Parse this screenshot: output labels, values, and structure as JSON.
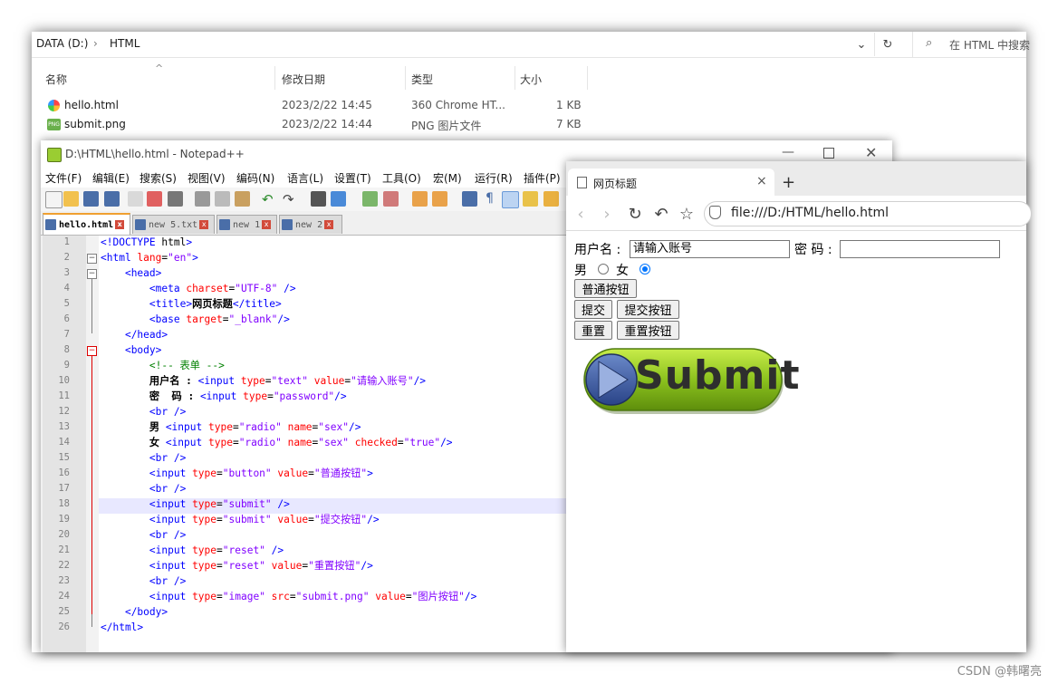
{
  "explorer": {
    "breadcrumb": [
      "DATA (D:)",
      "HTML"
    ],
    "search_placeholder": "在 HTML 中搜索",
    "columns": {
      "name": "名称",
      "date": "修改日期",
      "type": "类型",
      "size": "大小"
    },
    "files": [
      {
        "name": "hello.html",
        "date": "2023/2/22 14:45",
        "type": "360 Chrome HT...",
        "size": "1 KB"
      },
      {
        "name": "submit.png",
        "date": "2023/2/22 14:44",
        "type": "PNG 图片文件",
        "size": "7 KB"
      }
    ]
  },
  "notepad": {
    "title": "D:\\HTML\\hello.html - Notepad++",
    "menu": [
      "文件(F)",
      "编辑(E)",
      "搜索(S)",
      "视图(V)",
      "编码(N)",
      "语言(L)",
      "设置(T)",
      "工具(O)",
      "宏(M)",
      "运行(R)",
      "插件(P)"
    ],
    "tabs": [
      "hello.html",
      "new 5.txt",
      "new 1",
      "new 2"
    ],
    "line_numbers": [
      "1",
      "2",
      "3",
      "4",
      "5",
      "6",
      "7",
      "8",
      "9",
      "10",
      "11",
      "12",
      "13",
      "14",
      "15",
      "16",
      "17",
      "18",
      "19",
      "20",
      "21",
      "22",
      "23",
      "24",
      "25",
      "26"
    ],
    "code": [
      "<!DOCTYPE html>",
      "<html lang=\"en\">",
      "    <head>",
      "        <meta charset=\"UTF-8\" />",
      "        <title>网页标题</title>",
      "        <base target=\"_blank\"/>",
      "    </head>",
      "    <body>",
      "        <!-- 表单 -->",
      "        用户名 : <input type=\"text\" value=\"请输入账号\"/>",
      "        密  码 : <input type=\"password\"/>",
      "        <br />",
      "        男 <input type=\"radio\" name=\"sex\"/>",
      "        女 <input type=\"radio\" name=\"sex\" checked=\"true\"/>",
      "        <br />",
      "        <input type=\"button\" value=\"普通按钮\">",
      "        <br />",
      "        <input type=\"submit\" />",
      "        <input type=\"submit\" value=\"提交按钮\"/>",
      "        <br />",
      "        <input type=\"reset\" />",
      "        <input type=\"reset\" value=\"重置按钮\"/>",
      "        <br />",
      "        <input type=\"image\" src=\"submit.png\" value=\"图片按钮\"/>",
      "    </body>",
      "</html>"
    ]
  },
  "browser": {
    "tab_title": "网页标题",
    "url": "file:///D:/HTML/hello.html",
    "form": {
      "username_label": "用户名 :",
      "username_value": "请输入账号",
      "password_label": "密 码 :",
      "male_label": "男",
      "female_label": "女",
      "normal_button": "普通按钮",
      "submit_default": "提交",
      "submit_button": "提交按钮",
      "reset_default": "重置",
      "reset_button": "重置按钮",
      "image_button_text": "Submit",
      "gender_selected": "女"
    }
  },
  "watermark": "CSDN @韩曙亮",
  "colors": {
    "accent": "#0075ff",
    "tag": "#0000ff",
    "attr": "#ff0000",
    "value": "#8000ff",
    "comment": "#008000"
  }
}
